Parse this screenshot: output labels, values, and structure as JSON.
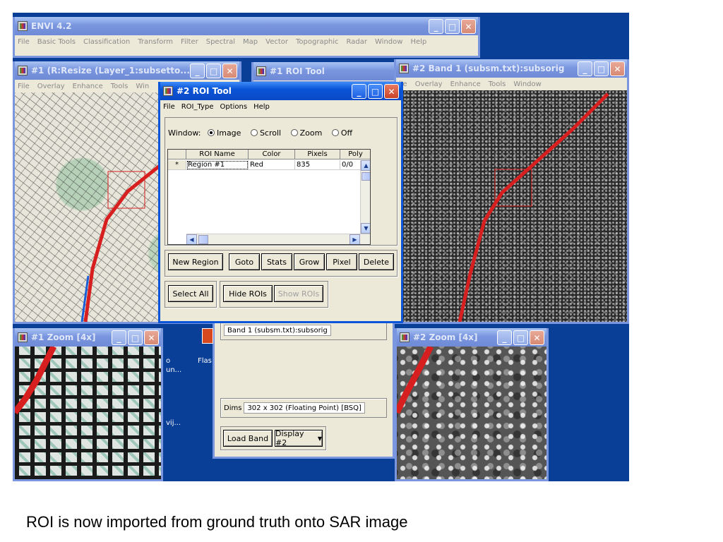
{
  "envi_main": {
    "title": "ENVI 4.2",
    "menu": [
      "File",
      "Basic Tools",
      "Classification",
      "Transform",
      "Filter",
      "Spectral",
      "Map",
      "Vector",
      "Topographic",
      "Radar",
      "Window",
      "Help"
    ]
  },
  "display1": {
    "title": "#1 (R:Resize (Layer_1:subsetto...",
    "menu": [
      "File",
      "Overlay",
      "Enhance",
      "Tools",
      "Win"
    ]
  },
  "roi_tool_bg": {
    "title": "#1 ROI Tool"
  },
  "display2": {
    "title": "#2 Band 1 (subsm.txt):subsorig",
    "menu": [
      "ile",
      "Overlay",
      "Enhance",
      "Tools",
      "Window"
    ]
  },
  "roi_tool": {
    "title": "#2 ROI Tool",
    "menu": [
      "File",
      "ROI_Type",
      "Options",
      "Help"
    ],
    "window_label": "Window:",
    "window_options": [
      {
        "label": "Image",
        "selected": true
      },
      {
        "label": "Scroll",
        "selected": false
      },
      {
        "label": "Zoom",
        "selected": false
      },
      {
        "label": "Off",
        "selected": false
      }
    ],
    "columns": [
      "ROI Name",
      "Color",
      "Pixels",
      "Poly"
    ],
    "rows": [
      {
        "marker": "*",
        "name": "Region #1",
        "color": "Red",
        "pixels": "835",
        "poly": "0/0"
      }
    ],
    "buttons_row1": [
      "New Region",
      "Goto",
      "Stats",
      "Grow",
      "Pixel",
      "Delete"
    ],
    "buttons_row2": [
      "Select All",
      "Hide ROIs",
      "Show ROIs"
    ]
  },
  "band_list": {
    "selected_band": "Band 1 (subsm.txt):subsorig",
    "dims_label": "Dims",
    "dims_value": "302 x 302 (Floating Point) [BSQ]",
    "load_button": "Load Band",
    "display_select": "Display #2"
  },
  "zoom1": {
    "title": "#1 Zoom [4x]"
  },
  "zoom2": {
    "title": "#2 Zoom [4x]"
  },
  "desktop_icons": [
    {
      "label": "Flas"
    },
    {
      "label": "o"
    },
    {
      "label": "un..."
    },
    {
      "label": "vij..."
    }
  ],
  "caption": "ROI is now imported from ground truth onto SAR image",
  "colors": {
    "roi": "#d81f1f",
    "desktop": "#0a3f98",
    "xp_title": "#0a54d6"
  }
}
